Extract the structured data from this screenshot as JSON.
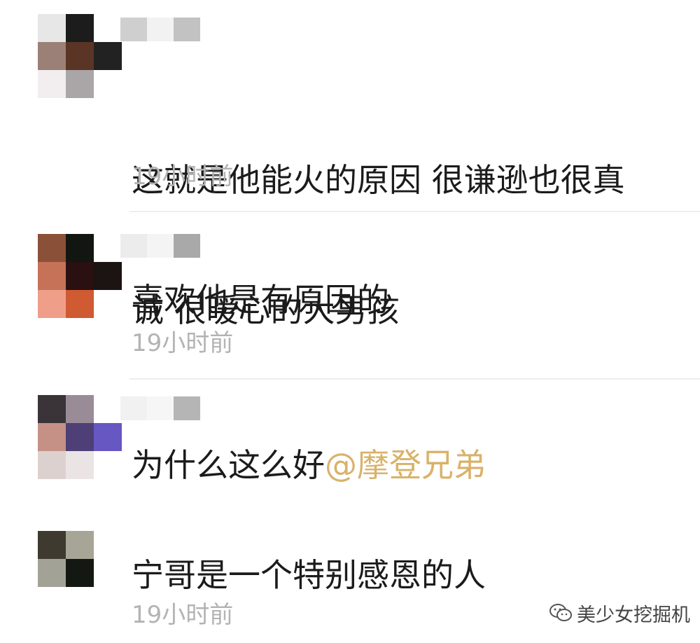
{
  "comments": [
    {
      "text_line1": "这就是他能火的原因 很谦逊也很真",
      "text_line2": "诚 很暖心的大男孩",
      "time": "19小时前"
    },
    {
      "text": "喜欢他是有原因的",
      "time": "19小时前"
    },
    {
      "text": "为什么这么好",
      "mention": "@摩登兄弟"
    },
    {
      "text": "宁哥是一个特别感恩的人",
      "time": "19小时前"
    }
  ],
  "watermark": {
    "label": "美少女挖掘机",
    "icon": "wechat-icon"
  },
  "colors": {
    "text": "#1b1b1b",
    "time": "#b3b3b3",
    "mention": "#d9b26a",
    "divider": "#eeeeee"
  }
}
